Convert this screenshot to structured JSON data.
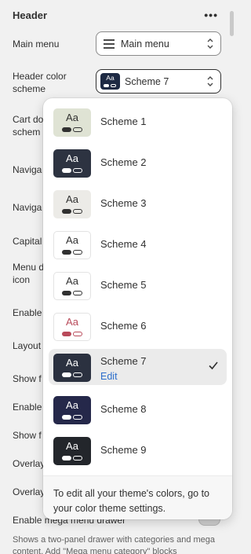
{
  "header": {
    "title": "Header",
    "more_icon": "more-horizontal-icon"
  },
  "settings": {
    "main_menu_label": "Main menu",
    "main_menu_value": "Main menu",
    "header_color_label_1": "Header color",
    "header_color_label_2": "scheme",
    "header_color_value": "Scheme 7",
    "header_color_swatch_text": "Aa",
    "cart_label_1": "Cart do",
    "cart_label_2": "schem",
    "navig_label_1": "Naviga",
    "navig_label_2": "Naviga",
    "capital_label": "Capital",
    "menu_label_1": "Menu d",
    "menu_label_2": "icon",
    "enable_label": "Enable",
    "layout_label": "Layout",
    "show_label_1": "Show f",
    "enable_label_2": "Enable",
    "show_label_2": "Show f",
    "overlay_label_1": "Overlay",
    "overlay_label_2": "Overlay",
    "mega_menu_label": "Enable mega menu drawer",
    "mega_menu_help": "Shows a two-panel drawer with categories and mega content. Add \"Mega menu category\" blocks"
  },
  "dropdown": {
    "options": [
      {
        "name": "Scheme 1",
        "aa": "Aa",
        "bg": "#dfe3d4",
        "fg": "#303030",
        "pill": "#303030"
      },
      {
        "name": "Scheme 2",
        "aa": "Aa",
        "bg": "#2d3341",
        "fg": "#ffffff",
        "pill": "#ffffff"
      },
      {
        "name": "Scheme 3",
        "aa": "Aa",
        "bg": "#ecebe7",
        "fg": "#303030",
        "pill": "#303030"
      },
      {
        "name": "Scheme 4",
        "aa": "Aa",
        "bg": "#ffffff",
        "fg": "#303030",
        "pill": "#303030"
      },
      {
        "name": "Scheme 5",
        "aa": "Aa",
        "bg": "#ffffff",
        "fg": "#303030",
        "pill": "#303030"
      },
      {
        "name": "Scheme 6",
        "aa": "Aa",
        "bg": "#ffffff",
        "fg": "#b94a5a",
        "pill": "#b94a5a"
      },
      {
        "name": "Scheme 7",
        "aa": "Aa",
        "bg": "#2b3140",
        "fg": "#ffffff",
        "pill": "#ffffff",
        "edit": "Edit",
        "selected": true
      },
      {
        "name": "Scheme 8",
        "aa": "Aa",
        "bg": "#25284a",
        "fg": "#ffffff",
        "pill": "#ffffff"
      },
      {
        "name": "Scheme 9",
        "aa": "Aa",
        "bg": "#23262b",
        "fg": "#ffffff",
        "pill": "#ffffff"
      }
    ],
    "footer_text": "To edit all your theme's colors, go to your color theme settings."
  },
  "colors": {
    "accent": "#2c6ecb",
    "text": "#303030",
    "panel": "#f1f1f1"
  }
}
